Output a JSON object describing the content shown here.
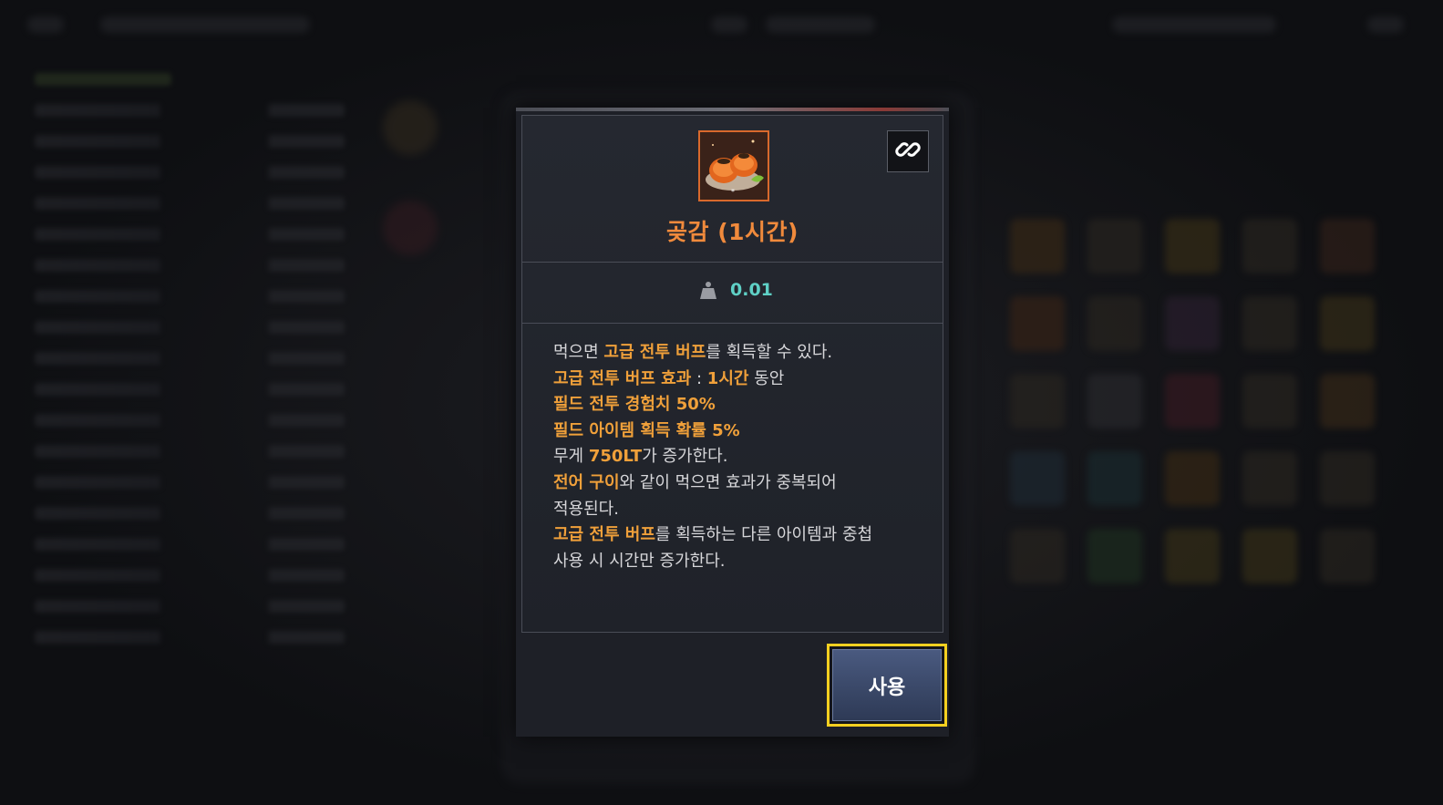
{
  "item": {
    "name": "곶감 (1시간)",
    "weight": "0.01",
    "icon": "dried-persimmon-icon",
    "name_color": "#f08a3c"
  },
  "description": {
    "l1_a": "먹으면 ",
    "l1_hl": "고급 전투 버프",
    "l1_b": "를 획득할 수 있다.",
    "l2_hl": "고급 전투 버프 효과",
    "l2_b": " : ",
    "l2_hl2": "1시간",
    "l2_c": " 동안",
    "l3_hl": "필드 전투 경험치 50%",
    "l4_hl": "필드 아이템 획득 확률 5%",
    "l5_a": "무게 ",
    "l5_hl": "750LT",
    "l5_b": "가 증가한다.",
    "l6_hl": "전어 구이",
    "l6_b": "와 같이 먹으면 효과가 중복되어",
    "l7": "적용된다.",
    "l8_hl": "고급 전투 버프",
    "l8_b": "를 획득하는 다른 아이템과 중첩",
    "l9": "사용 시 시간만 증가한다."
  },
  "actions": {
    "use_label": "사용",
    "link_icon": "chain-link-icon"
  },
  "colors": {
    "highlight": "#f0a03a",
    "weight": "#5fd0c6",
    "focus_border": "#f5d020"
  }
}
